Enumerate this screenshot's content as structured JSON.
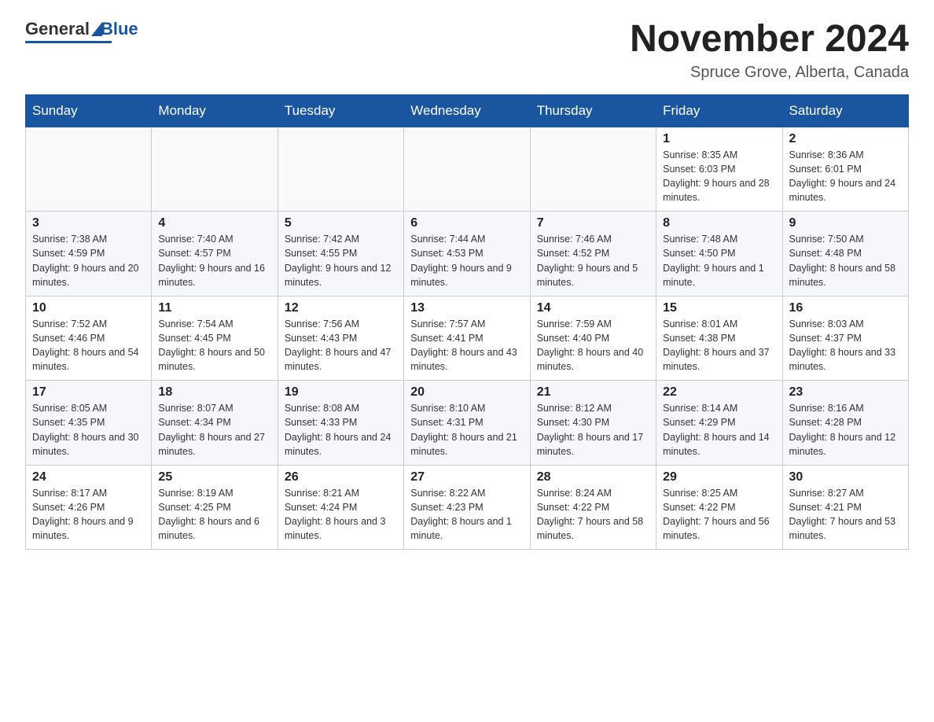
{
  "header": {
    "logo_general": "General",
    "logo_blue": "Blue",
    "month_year": "November 2024",
    "location": "Spruce Grove, Alberta, Canada"
  },
  "weekdays": [
    "Sunday",
    "Monday",
    "Tuesday",
    "Wednesday",
    "Thursday",
    "Friday",
    "Saturday"
  ],
  "weeks": [
    [
      {
        "day": "",
        "info": ""
      },
      {
        "day": "",
        "info": ""
      },
      {
        "day": "",
        "info": ""
      },
      {
        "day": "",
        "info": ""
      },
      {
        "day": "",
        "info": ""
      },
      {
        "day": "1",
        "info": "Sunrise: 8:35 AM\nSunset: 6:03 PM\nDaylight: 9 hours and 28 minutes."
      },
      {
        "day": "2",
        "info": "Sunrise: 8:36 AM\nSunset: 6:01 PM\nDaylight: 9 hours and 24 minutes."
      }
    ],
    [
      {
        "day": "3",
        "info": "Sunrise: 7:38 AM\nSunset: 4:59 PM\nDaylight: 9 hours and 20 minutes."
      },
      {
        "day": "4",
        "info": "Sunrise: 7:40 AM\nSunset: 4:57 PM\nDaylight: 9 hours and 16 minutes."
      },
      {
        "day": "5",
        "info": "Sunrise: 7:42 AM\nSunset: 4:55 PM\nDaylight: 9 hours and 12 minutes."
      },
      {
        "day": "6",
        "info": "Sunrise: 7:44 AM\nSunset: 4:53 PM\nDaylight: 9 hours and 9 minutes."
      },
      {
        "day": "7",
        "info": "Sunrise: 7:46 AM\nSunset: 4:52 PM\nDaylight: 9 hours and 5 minutes."
      },
      {
        "day": "8",
        "info": "Sunrise: 7:48 AM\nSunset: 4:50 PM\nDaylight: 9 hours and 1 minute."
      },
      {
        "day": "9",
        "info": "Sunrise: 7:50 AM\nSunset: 4:48 PM\nDaylight: 8 hours and 58 minutes."
      }
    ],
    [
      {
        "day": "10",
        "info": "Sunrise: 7:52 AM\nSunset: 4:46 PM\nDaylight: 8 hours and 54 minutes."
      },
      {
        "day": "11",
        "info": "Sunrise: 7:54 AM\nSunset: 4:45 PM\nDaylight: 8 hours and 50 minutes."
      },
      {
        "day": "12",
        "info": "Sunrise: 7:56 AM\nSunset: 4:43 PM\nDaylight: 8 hours and 47 minutes."
      },
      {
        "day": "13",
        "info": "Sunrise: 7:57 AM\nSunset: 4:41 PM\nDaylight: 8 hours and 43 minutes."
      },
      {
        "day": "14",
        "info": "Sunrise: 7:59 AM\nSunset: 4:40 PM\nDaylight: 8 hours and 40 minutes."
      },
      {
        "day": "15",
        "info": "Sunrise: 8:01 AM\nSunset: 4:38 PM\nDaylight: 8 hours and 37 minutes."
      },
      {
        "day": "16",
        "info": "Sunrise: 8:03 AM\nSunset: 4:37 PM\nDaylight: 8 hours and 33 minutes."
      }
    ],
    [
      {
        "day": "17",
        "info": "Sunrise: 8:05 AM\nSunset: 4:35 PM\nDaylight: 8 hours and 30 minutes."
      },
      {
        "day": "18",
        "info": "Sunrise: 8:07 AM\nSunset: 4:34 PM\nDaylight: 8 hours and 27 minutes."
      },
      {
        "day": "19",
        "info": "Sunrise: 8:08 AM\nSunset: 4:33 PM\nDaylight: 8 hours and 24 minutes."
      },
      {
        "day": "20",
        "info": "Sunrise: 8:10 AM\nSunset: 4:31 PM\nDaylight: 8 hours and 21 minutes."
      },
      {
        "day": "21",
        "info": "Sunrise: 8:12 AM\nSunset: 4:30 PM\nDaylight: 8 hours and 17 minutes."
      },
      {
        "day": "22",
        "info": "Sunrise: 8:14 AM\nSunset: 4:29 PM\nDaylight: 8 hours and 14 minutes."
      },
      {
        "day": "23",
        "info": "Sunrise: 8:16 AM\nSunset: 4:28 PM\nDaylight: 8 hours and 12 minutes."
      }
    ],
    [
      {
        "day": "24",
        "info": "Sunrise: 8:17 AM\nSunset: 4:26 PM\nDaylight: 8 hours and 9 minutes."
      },
      {
        "day": "25",
        "info": "Sunrise: 8:19 AM\nSunset: 4:25 PM\nDaylight: 8 hours and 6 minutes."
      },
      {
        "day": "26",
        "info": "Sunrise: 8:21 AM\nSunset: 4:24 PM\nDaylight: 8 hours and 3 minutes."
      },
      {
        "day": "27",
        "info": "Sunrise: 8:22 AM\nSunset: 4:23 PM\nDaylight: 8 hours and 1 minute."
      },
      {
        "day": "28",
        "info": "Sunrise: 8:24 AM\nSunset: 4:22 PM\nDaylight: 7 hours and 58 minutes."
      },
      {
        "day": "29",
        "info": "Sunrise: 8:25 AM\nSunset: 4:22 PM\nDaylight: 7 hours and 56 minutes."
      },
      {
        "day": "30",
        "info": "Sunrise: 8:27 AM\nSunset: 4:21 PM\nDaylight: 7 hours and 53 minutes."
      }
    ]
  ]
}
